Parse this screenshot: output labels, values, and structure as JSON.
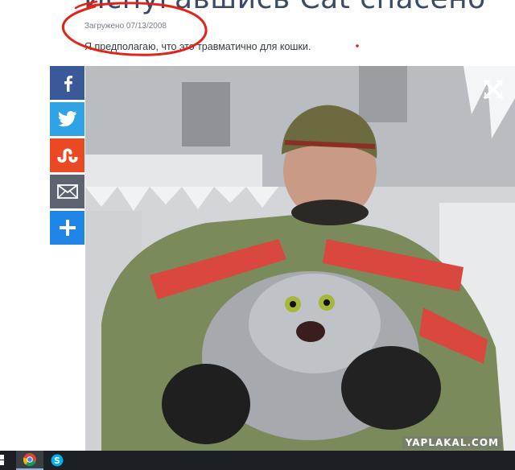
{
  "article": {
    "title": "Испугавшись Cat спасено",
    "upload_date": "Загружено 07/13/2008",
    "caption": "Я предполагаю, что это травматично для кошки."
  },
  "share_bar": {
    "buttons": [
      {
        "name": "facebook",
        "icon": "facebook-icon",
        "color": "#3b5998"
      },
      {
        "name": "twitter",
        "icon": "twitter-icon",
        "color": "#2fa3e6"
      },
      {
        "name": "stumbleupon",
        "icon": "stumbleupon-icon",
        "color": "#eb4924"
      },
      {
        "name": "email",
        "icon": "envelope-icon",
        "color": "#5d6370"
      },
      {
        "name": "more",
        "icon": "plus-icon",
        "color": "#1f86e8"
      }
    ]
  },
  "image": {
    "description_icon": "photo",
    "watermark": "YAPLAKAL.COM",
    "close_icon": "close-icon"
  },
  "taskbar": {
    "items": [
      {
        "icon": "start-icon"
      },
      {
        "icon": "chrome-icon"
      },
      {
        "icon": "skype-icon"
      }
    ]
  },
  "annotation_color": "#e2231a"
}
